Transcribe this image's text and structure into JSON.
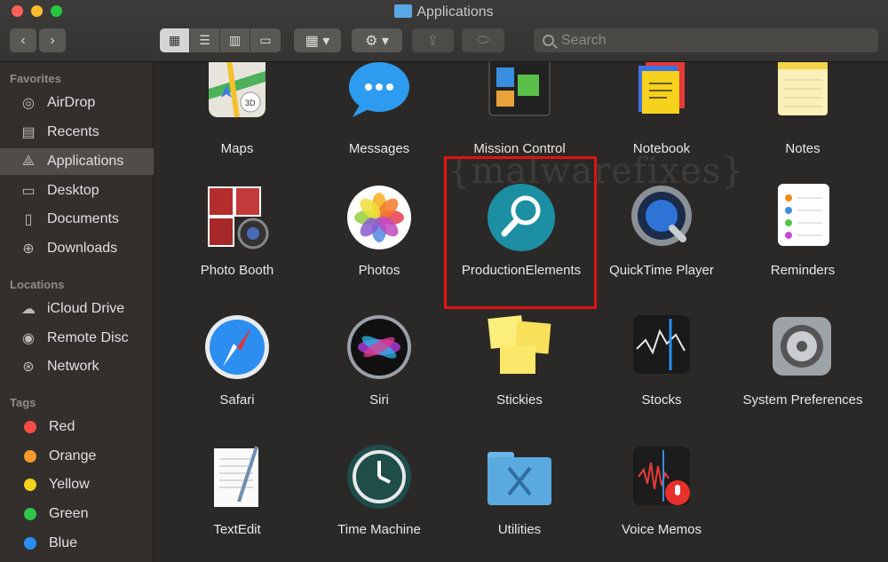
{
  "window": {
    "title": "Applications"
  },
  "toolbar": {
    "back": "‹",
    "forward": "›",
    "view_buttons": [
      "icon-view",
      "list-view",
      "column-view",
      "gallery-view"
    ],
    "search_placeholder": "Search"
  },
  "sidebar": {
    "favorites_title": "Favorites",
    "favorites": [
      {
        "label": "AirDrop",
        "icon": "airdrop-icon"
      },
      {
        "label": "Recents",
        "icon": "recents-icon"
      },
      {
        "label": "Applications",
        "icon": "applications-icon"
      },
      {
        "label": "Desktop",
        "icon": "desktop-icon"
      },
      {
        "label": "Documents",
        "icon": "documents-icon"
      },
      {
        "label": "Downloads",
        "icon": "downloads-icon"
      }
    ],
    "locations_title": "Locations",
    "locations": [
      {
        "label": "iCloud Drive",
        "icon": "icloud-icon"
      },
      {
        "label": "Remote Disc",
        "icon": "disc-icon"
      },
      {
        "label": "Network",
        "icon": "network-icon"
      }
    ],
    "tags_title": "Tags",
    "tags": [
      {
        "label": "Red",
        "color": "#fe4c44"
      },
      {
        "label": "Orange",
        "color": "#f9992b"
      },
      {
        "label": "Yellow",
        "color": "#f5d21e"
      },
      {
        "label": "Green",
        "color": "#2fc54a"
      },
      {
        "label": "Blue",
        "color": "#2a8ef5"
      }
    ]
  },
  "content": {
    "watermark": "{malwarefixes}",
    "apps": [
      [
        "Maps",
        "Messages",
        "Mission Control",
        "Notebook",
        "Notes"
      ],
      [
        "Photo Booth",
        "Photos",
        "ProductionElements",
        "QuickTime Player",
        "Reminders"
      ],
      [
        "Safari",
        "Siri",
        "Stickies",
        "Stocks",
        "System Preferences"
      ],
      [
        "TextEdit",
        "Time Machine",
        "Utilities",
        "Voice Memos"
      ]
    ]
  }
}
